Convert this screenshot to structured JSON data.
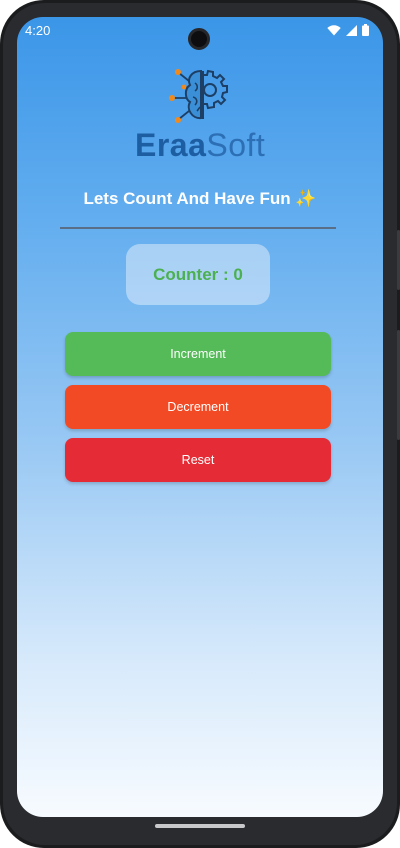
{
  "status_bar": {
    "time": "4:20",
    "icons": [
      "wifi-icon",
      "signal-icon",
      "battery-icon"
    ]
  },
  "logo": {
    "text_bold": "Eraa",
    "text_light": "Soft"
  },
  "title": "Lets Count And Have Fun ✨",
  "counter": {
    "label": "Counter : 0",
    "color": "#4cb050"
  },
  "buttons": {
    "increment": "Increment",
    "decrement": "Decrement",
    "reset": "Reset"
  },
  "colors": {
    "increment": "#55bb58",
    "decrement": "#f14a25",
    "reset": "#e52c36",
    "logo": "#1d5ea3"
  }
}
